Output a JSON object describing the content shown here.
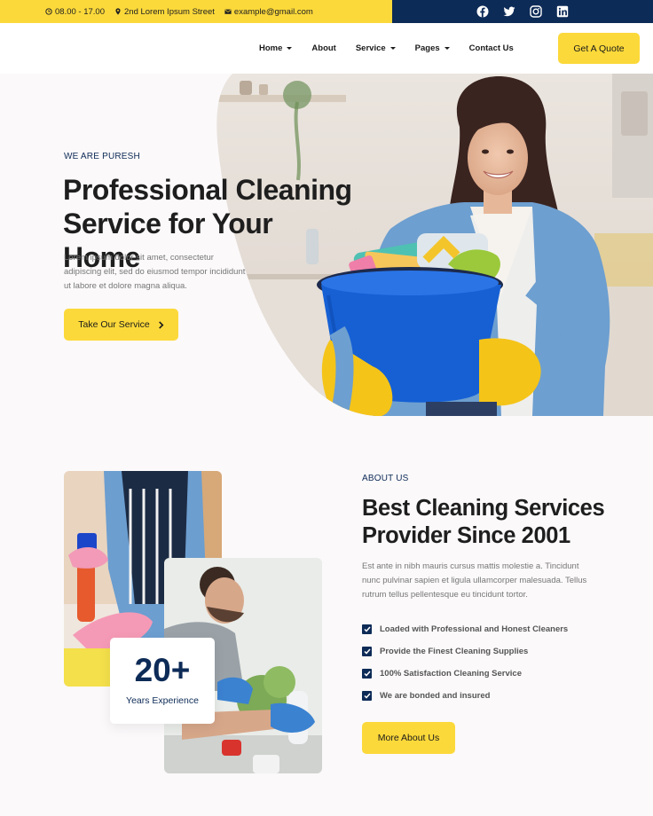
{
  "topbar": {
    "hours": "08.00 - 17.00",
    "address": "2nd Lorem Ipsum Street",
    "email": "example@gmail.com",
    "socials": [
      "facebook-icon",
      "twitter-icon",
      "instagram-icon",
      "linkedin-icon"
    ]
  },
  "nav": {
    "items": [
      {
        "label": "Home",
        "dropdown": true
      },
      {
        "label": "About",
        "dropdown": false
      },
      {
        "label": "Service",
        "dropdown": true
      },
      {
        "label": "Pages",
        "dropdown": true
      },
      {
        "label": "Contact Us",
        "dropdown": false
      }
    ],
    "cta": "Get A Quote"
  },
  "hero": {
    "eyebrow": "WE ARE PURESH",
    "title": "Professional Cleaning Service for Your Home",
    "description": "Lorem ipsum dolor sit amet, consectetur adipiscing elit, sed do eiusmod tempor incididunt ut labore et dolore magna aliqua.",
    "button": "Take Our Service"
  },
  "about": {
    "experience_number": "20+",
    "experience_label": "Years Experience",
    "eyebrow": "ABOUT US",
    "title": "Best Cleaning Services Provider Since 2001",
    "description": "Est ante in nibh mauris cursus mattis molestie a. Tincidunt nunc pulvinar sapien et ligula ullamcorper malesuada. Tellus rutrum tellus pellentesque eu tincidunt tortor.",
    "checklist": [
      "Loaded with Professional and Honest Cleaners",
      "Provide the Finest Cleaning Supplies",
      "100% Satisfaction Cleaning Service",
      "We are bonded and insured"
    ],
    "button": "More About Us"
  },
  "colors": {
    "accent_yellow": "#fcd93a",
    "navy": "#0d2b57"
  }
}
